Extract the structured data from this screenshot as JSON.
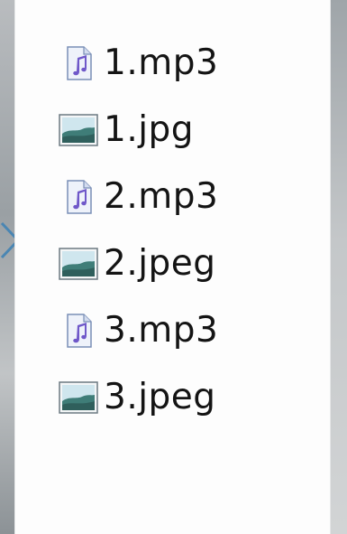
{
  "files": [
    {
      "name": "1.mp3",
      "icon": "audio-file-icon"
    },
    {
      "name": "1.jpg",
      "icon": "image-file-icon"
    },
    {
      "name": "2.mp3",
      "icon": "audio-file-icon"
    },
    {
      "name": "2.jpeg",
      "icon": "image-file-icon"
    },
    {
      "name": "3.mp3",
      "icon": "audio-file-icon"
    },
    {
      "name": "3.jpeg",
      "icon": "image-file-icon"
    }
  ],
  "colors": {
    "panel_background": "#fdfdfd",
    "text": "#141414",
    "arrow": "#4a86b3"
  }
}
